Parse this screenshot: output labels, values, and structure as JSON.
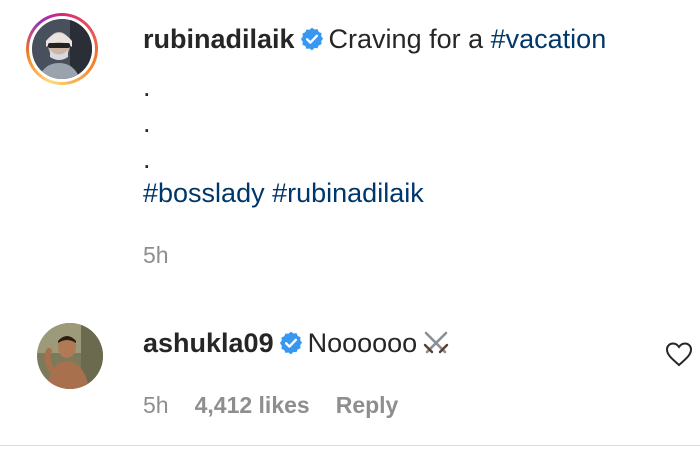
{
  "post": {
    "username": "rubinadilaik",
    "caption_prefix": "Craving for a ",
    "caption_hashtag": "#vacation",
    "dots": [
      ".",
      ".",
      "."
    ],
    "tag_1": "#bosslady",
    "tag_2": "#rubinadilaik",
    "time": "5h"
  },
  "comment": {
    "username": "ashukla09",
    "text": "Noooooo",
    "emoji": "crossed-swords",
    "time": "5h",
    "likes": "4,412 likes",
    "reply": "Reply"
  },
  "icons": {
    "verified": "verified-badge-icon",
    "like": "heart-outline-icon"
  },
  "colors": {
    "text": "#262626",
    "hashtag": "#00376b",
    "secondary": "#8e8e8e",
    "verified": "#3897f0"
  }
}
